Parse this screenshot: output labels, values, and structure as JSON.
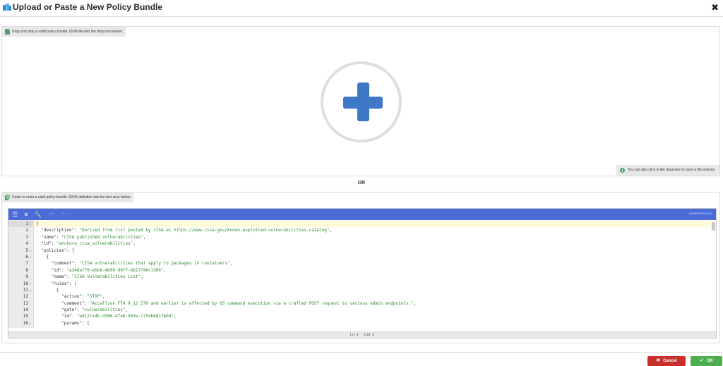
{
  "header": {
    "title": "Upload or Paste a New Policy Bundle",
    "close_glyph": "✖"
  },
  "dropzone": {
    "label": "Drag and drop a valid policy bundle JSON file into the dropzone below:",
    "hint": "You can also click in the dropzone to open a file selector"
  },
  "separator": {
    "text": "OR"
  },
  "paste": {
    "label": "Paste or enter a valid policy bundle JSON definition into the text area below:"
  },
  "editor": {
    "powered_by": "powered by ace",
    "status": {
      "line": "Ln: 1",
      "col": "Col: 1"
    },
    "lines": [
      {
        "n": "1",
        "fold": true,
        "text": "{"
      },
      {
        "n": "2",
        "fold": false,
        "indent": "  ",
        "key": "\"description\"",
        "value": "\"Derived from list posted by CISA at https://www.cisa.gov/known-exploited-vulnerabilities-catalog\"",
        "tail": ","
      },
      {
        "n": "3",
        "fold": false,
        "indent": "  ",
        "key": "\"name\"",
        "value": "\"CISA published vulnerabilities\"",
        "tail": ","
      },
      {
        "n": "4",
        "fold": false,
        "indent": "  ",
        "key": "\"id\"",
        "value": "\"anchore_cisa_vulnerabilities\"",
        "tail": ","
      },
      {
        "n": "5",
        "fold": true,
        "indent": "  ",
        "key": "\"policies\"",
        "value": "",
        "tail": "["
      },
      {
        "n": "6",
        "fold": true,
        "indent": "    ",
        "text": "{"
      },
      {
        "n": "7",
        "fold": false,
        "indent": "      ",
        "key": "\"comment\"",
        "value": "\"CISA vulnerabilities that apply to packages in containers\"",
        "tail": ","
      },
      {
        "n": "8",
        "fold": false,
        "indent": "      ",
        "key": "\"id\"",
        "value": "\"a348aff0-ebb8-4b90-99ff-bb17740c1306\"",
        "tail": ","
      },
      {
        "n": "9",
        "fold": false,
        "indent": "      ",
        "key": "\"name\"",
        "value": "\"CISA Vulnerabilities List\"",
        "tail": ","
      },
      {
        "n": "10",
        "fold": true,
        "indent": "      ",
        "key": "\"rules\"",
        "value": "",
        "tail": "["
      },
      {
        "n": "11",
        "fold": true,
        "indent": "        ",
        "text": "{"
      },
      {
        "n": "12",
        "fold": false,
        "indent": "          ",
        "key": "\"action\"",
        "value": "\"STOP\"",
        "tail": ","
      },
      {
        "n": "13",
        "fold": false,
        "indent": "          ",
        "key": "\"comment\"",
        "value": "\"Accellion FTA 9_12_370 and earlier is affected by OS command execution via a crafted POST request to various admin endpoints.\"",
        "tail": ","
      },
      {
        "n": "14",
        "fold": false,
        "indent": "          ",
        "key": "\"gate\"",
        "value": "\"vulnerabilities\"",
        "tail": ","
      },
      {
        "n": "15",
        "fold": false,
        "indent": "          ",
        "key": "\"id\"",
        "value": "\"e612114b-d360-4fa0-993e-c754b8817604\"",
        "tail": ","
      },
      {
        "n": "16",
        "fold": true,
        "indent": "          ",
        "key": "\"params\"",
        "value": "",
        "tail": "["
      }
    ]
  },
  "footer": {
    "cancel_label": "Cancel",
    "ok_label": "OK"
  },
  "colors": {
    "toolbar": "#4a6bd8",
    "plus": "#3f78c6",
    "cancel": "#c9302c",
    "ok": "#4cae4c",
    "json_string": "#2e8b2e"
  }
}
